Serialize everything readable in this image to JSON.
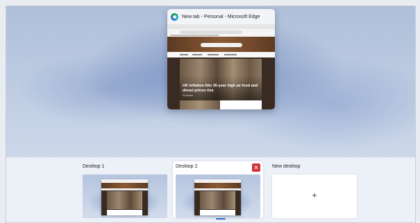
{
  "window_preview": {
    "title": "New tab - Personal - Microsoft Edge",
    "app_icon": "edge-icon",
    "headline": "UK inflation hits 30-year high as food and diesel prices rise",
    "source": "PA Media"
  },
  "desktops": [
    {
      "label": "Desktop 1",
      "active": false
    },
    {
      "label": "Desktop 2",
      "active": true,
      "close_label": "✕"
    },
    {
      "label": "New desktop",
      "add_label": "+"
    }
  ],
  "colors": {
    "close_button": "#d13438",
    "active_indicator": "#2b66c4"
  }
}
